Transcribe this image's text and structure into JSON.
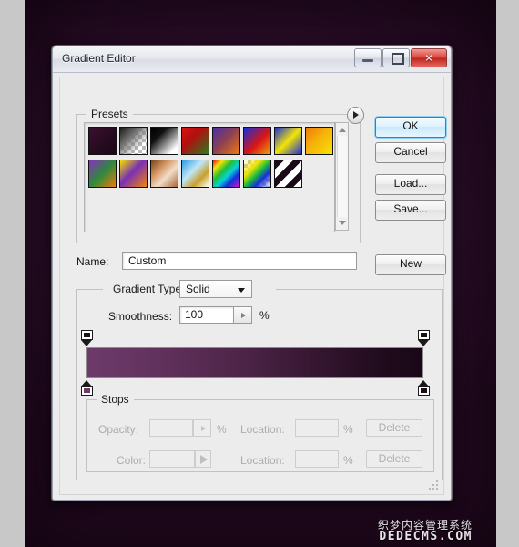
{
  "window": {
    "title": "Gradient Editor",
    "controls": {
      "minimize": "minimize",
      "maximize": "maximize",
      "close": "✕"
    }
  },
  "presets": {
    "legend": "Presets",
    "menu_icon": "preset-menu-arrow-icon",
    "scroll_up_icon": "scroll-up-arrow-icon",
    "scroll_down_icon": "scroll-down-arrow-icon",
    "swatches": [
      {
        "name": "violet-black",
        "css": "linear-gradient(135deg,#3a1030 0%,#2a0c22 45%,#1b0716 100%)",
        "checker": false
      },
      {
        "name": "black-to-transparent",
        "css": "linear-gradient(135deg,#1a1a1a 0%,#6e6e6e 35%,rgba(200,200,200,0) 75%)",
        "checker": true
      },
      {
        "name": "black-white",
        "css": "linear-gradient(135deg,#000 0%,#101010 30%,#ffffff 85%)",
        "checker": false
      },
      {
        "name": "red-green",
        "css": "linear-gradient(135deg,#d81212 0%,#b01010 40%,#2d7a1c 100%)",
        "checker": false
      },
      {
        "name": "violet-orange",
        "css": "linear-gradient(135deg,#4b2fa8 0%,#8a3f55 45%,#f07a10 100%)",
        "checker": false
      },
      {
        "name": "blue-red-yellow",
        "css": "linear-gradient(135deg,#1530d8 0%,#d81515 55%,#f2a10c 100%)",
        "checker": false
      },
      {
        "name": "blue-yellow-blue",
        "css": "linear-gradient(135deg,#1a2ed6 0%,#f2e408 50%,#1a2ed6 100%)",
        "checker": false
      },
      {
        "name": "orange-yellow",
        "css": "linear-gradient(135deg,#f07a0a 0%,#f5b20a 45%,#f7e400 100%)",
        "checker": false
      },
      {
        "name": "violet-green-orange",
        "css": "linear-gradient(135deg,#8a2fbe 0%,#2d8a3c 50%,#f07a0a 100%)",
        "checker": false
      },
      {
        "name": "yellow-violet-orange",
        "css": "linear-gradient(135deg,#f5e000 0%,#7a2fb5 45%,#f0850a 100%)",
        "checker": false
      },
      {
        "name": "copper",
        "css": "linear-gradient(135deg,#7a4418 0%,#d89a6a 35%,#f2ddc8 60%,#a8643a 100%)",
        "checker": false
      },
      {
        "name": "blue-gold-white",
        "css": "linear-gradient(135deg,#2f9ae0 0%,#bfe6f7 40%,#c8a02a 70%,#ffffff 100%)",
        "checker": false
      },
      {
        "name": "spectrum",
        "css": "linear-gradient(135deg,#e51515 0%,#f2e408 18%,#1fbf3a 38%,#0ad0d8 56%,#1530d8 74%,#d815c8 100%)",
        "checker": false
      },
      {
        "name": "transparent-rainbow",
        "css": "linear-gradient(135deg,rgba(255,255,255,0) 0%,#f2e408 30%,#1fbf3a 50%,#1530d8 70%,rgba(255,255,255,0) 100%)",
        "checker": true
      },
      {
        "name": "black-white-stripes",
        "css": "repeating-linear-gradient(135deg,#1a0a18 0px,#1a0a18 7px,#ffffff 7px,#ffffff 14px)",
        "checker": true
      }
    ]
  },
  "buttons": {
    "ok": "OK",
    "cancel": "Cancel",
    "load": "Load...",
    "save": "Save...",
    "new": "New"
  },
  "name_row": {
    "label": "Name:",
    "value": "Custom"
  },
  "gradient_type": {
    "label": "Gradient Type:",
    "value": "Solid",
    "caret_icon": "chevron-down-icon"
  },
  "smoothness": {
    "label": "Smoothness:",
    "value": "100",
    "unit": "%",
    "spin_icon": "spinner-arrow-icon"
  },
  "gradient_bar": {
    "css": "linear-gradient(to right,#6d3a6a 0%,#63335f 18%,#4e2549 45%,#33152f 70%,#200b1d 88%,#190717 100%)",
    "stops": [
      {
        "name": "opacity-stop-left",
        "position": "0%",
        "side": "top",
        "color": "#151515"
      },
      {
        "name": "opacity-stop-right",
        "position": "100%",
        "side": "top",
        "color": "#151515"
      },
      {
        "name": "color-stop-left",
        "position": "0%",
        "side": "bottom",
        "color": "#6d3a6a"
      },
      {
        "name": "color-stop-right",
        "position": "100%",
        "side": "bottom",
        "color": "#1d0a1a"
      }
    ]
  },
  "stops_section": {
    "legend": "Stops",
    "opacity_label": "Opacity:",
    "opacity_value": "",
    "opacity_unit": "%",
    "location1_label": "Location:",
    "location1_value": "",
    "location1_unit": "%",
    "delete1": "Delete",
    "color_label": "Color:",
    "color_value": "",
    "location2_label": "Location:",
    "location2_value": "",
    "location2_unit": "%",
    "delete2": "Delete"
  },
  "watermark": {
    "cn": "织梦内容管理系统",
    "en": "DEDECMS.COM"
  }
}
